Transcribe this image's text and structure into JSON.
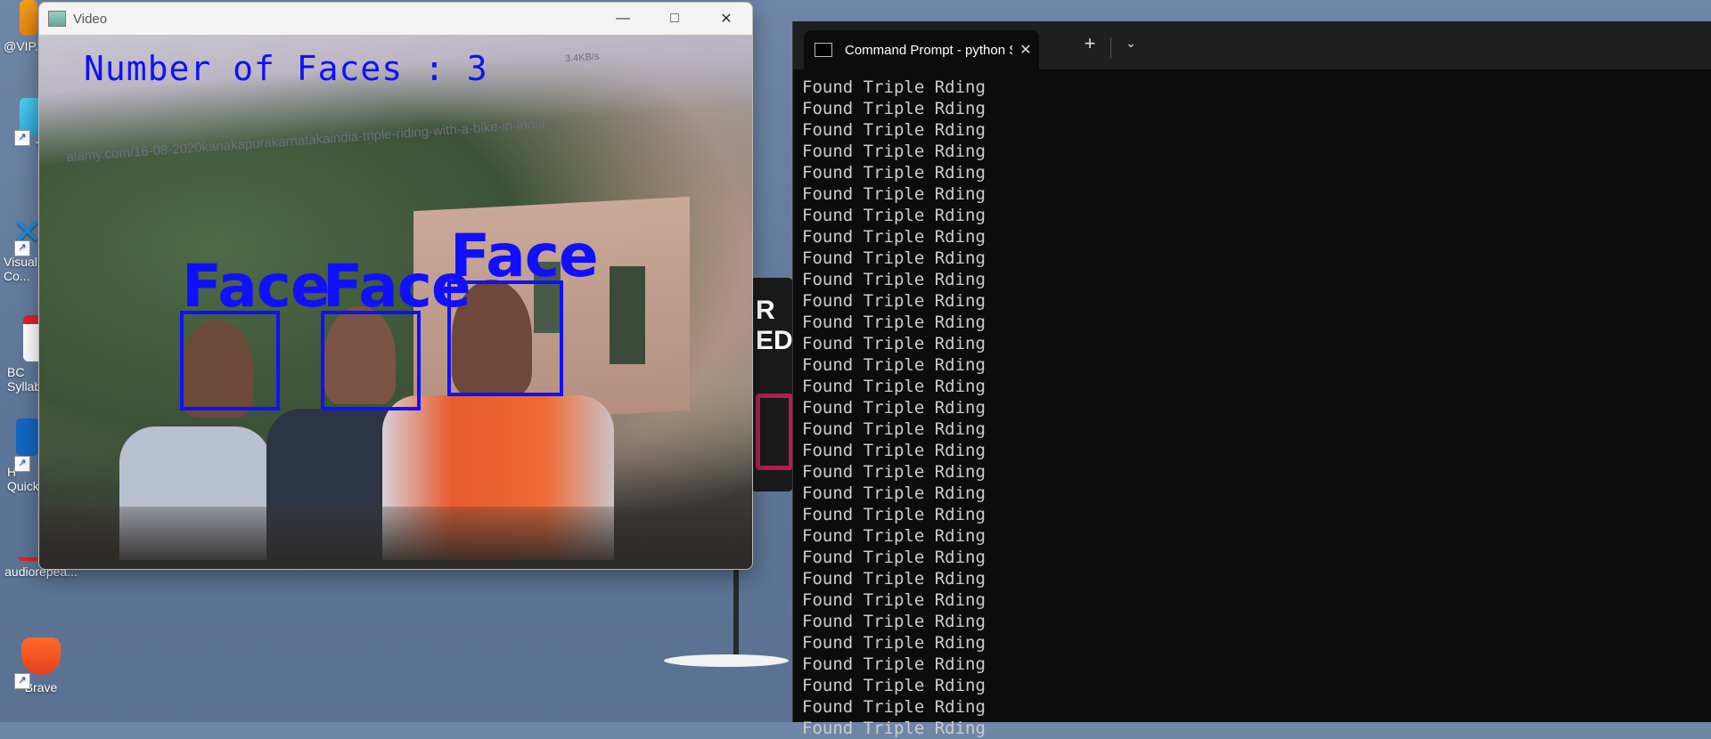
{
  "desktop": {
    "icons": [
      {
        "label": "@VIP...",
        "name": "vip-icon"
      },
      {
        "label": "Thi...",
        "name": "this-pc-icon"
      },
      {
        "label": "Visual\nCo...",
        "name": "vscode-icon"
      },
      {
        "label": "BC\nSyllab...",
        "name": "pdf-icon"
      },
      {
        "label": "H\nQuick...",
        "name": "quick-assist-icon"
      },
      {
        "label": "audiorepea...",
        "name": "audio-repeat-icon"
      },
      {
        "label": "Brave",
        "name": "brave-icon"
      }
    ]
  },
  "video_window": {
    "title": "Video",
    "minimize": "—",
    "maximize": "□",
    "close": "✕",
    "overlay_count_text": "Number of Faces : 3",
    "face_label": "Face",
    "screen_url_text": "alamy.com/16-08-2020kanakapurakarnatakaindia-triple-riding-with-a-bike-in-india-",
    "screen_speed_text": "3.4KB/s"
  },
  "background_sign": {
    "text_line1": "R",
    "text_line2": "ED"
  },
  "terminal": {
    "tab_title": "Command Prompt - python S",
    "tab_close": "✕",
    "new_tab": "+",
    "dropdown": "⌄",
    "output_lines": [
      "Found Triple Rding",
      "Found Triple Rding",
      "Found Triple Rding",
      "Found Triple Rding",
      "Found Triple Rding",
      "Found Triple Rding",
      "Found Triple Rding",
      "Found Triple Rding",
      "Found Triple Rding",
      "Found Triple Rding",
      "Found Triple Rding",
      "Found Triple Rding",
      "Found Triple Rding",
      "Found Triple Rding",
      "Found Triple Rding",
      "Found Triple Rding",
      "Found Triple Rding",
      "Found Triple Rding",
      "Found Triple Rding",
      "Found Triple Rding",
      "Found Triple Rding",
      "Found Triple Rding",
      "Found Triple Rding",
      "Found Triple Rding",
      "Found Triple Rding",
      "Found Triple Rding",
      "Found Triple Rding",
      "Found Triple Rding",
      "Found Triple Rding",
      "Found Triple Rding",
      "Found Triple Rding"
    ]
  },
  "colors": {
    "detection_blue": "#1010ff",
    "terminal_bg": "#0c0c0c",
    "terminal_text": "#cccccc"
  }
}
